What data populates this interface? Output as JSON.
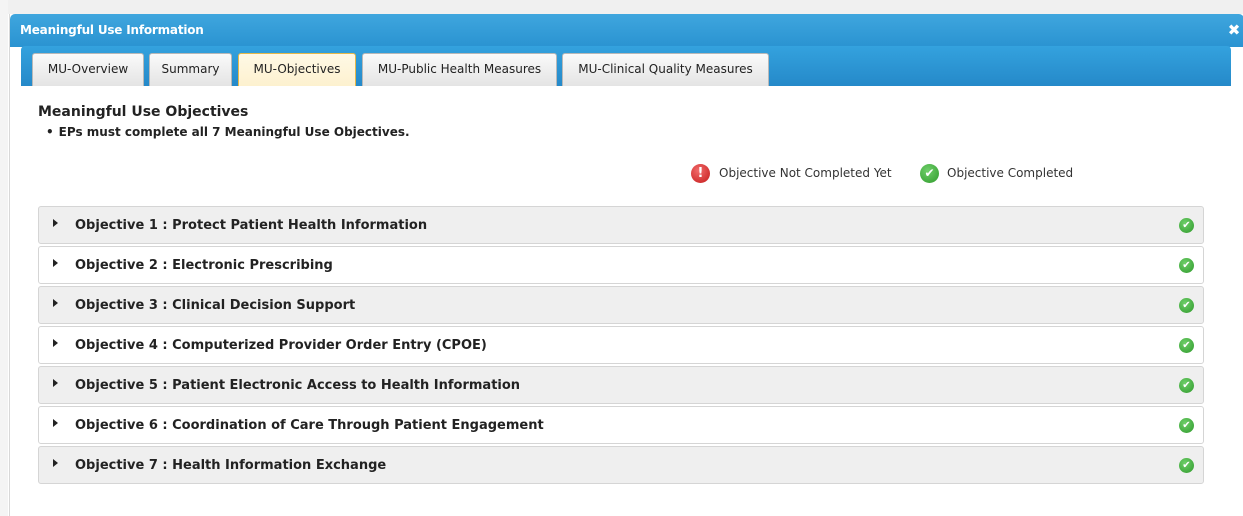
{
  "dialog": {
    "title": "Meaningful Use Information",
    "close_glyph": "✖"
  },
  "tabs": [
    {
      "label": "MU-Overview",
      "active": false
    },
    {
      "label": "Summary",
      "active": false
    },
    {
      "label": "MU-Objectives",
      "active": true
    },
    {
      "label": "MU-Public Health Measures",
      "active": false
    },
    {
      "label": "MU-Clinical Quality Measures",
      "active": false
    }
  ],
  "content": {
    "heading": "Meaningful Use Objectives",
    "bullet": "EPs must complete all 7 Meaningful Use Objectives.",
    "bullet_glyph": "•"
  },
  "legend": {
    "not_completed_label": "Objective Not Completed Yet",
    "not_completed_icon": "exclamation-circle-icon",
    "not_completed_glyph": "!",
    "completed_label": "Objective Completed",
    "completed_icon": "check-circle-icon",
    "completed_glyph": "✔"
  },
  "colors": {
    "accent_blue": "#2a93d1",
    "status_red": "#c41919",
    "status_green": "#2f9a2b"
  },
  "objectives": [
    {
      "label": "Objective 1 : Protect Patient Health Information",
      "completed": true,
      "status_glyph": "✔"
    },
    {
      "label": "Objective 2 : Electronic Prescribing",
      "completed": true,
      "status_glyph": "✔"
    },
    {
      "label": "Objective 3 : Clinical Decision Support",
      "completed": true,
      "status_glyph": "✔"
    },
    {
      "label": "Objective 4 : Computerized Provider Order Entry (CPOE)",
      "completed": true,
      "status_glyph": "✔"
    },
    {
      "label": "Objective 5 : Patient Electronic Access to Health Information",
      "completed": true,
      "status_glyph": "✔"
    },
    {
      "label": "Objective 6 : Coordination of Care Through Patient Engagement",
      "completed": true,
      "status_glyph": "✔"
    },
    {
      "label": "Objective 7 : Health Information Exchange",
      "completed": true,
      "status_glyph": "✔"
    }
  ]
}
